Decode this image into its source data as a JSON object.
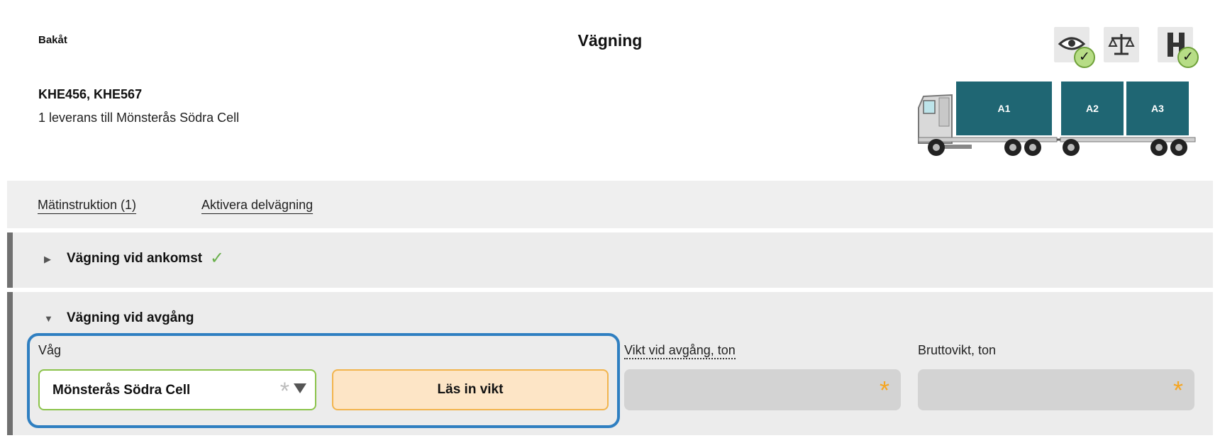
{
  "header": {
    "back_label": "Bakåt",
    "title": "Vägning",
    "trucks": "KHE456, KHE567",
    "delivery": "1 leverans till Mönsterås Södra Cell"
  },
  "status_icons": [
    {
      "name": "eye-icon",
      "checked": true
    },
    {
      "name": "scale-icon",
      "checked": false
    },
    {
      "name": "road-icon",
      "checked": true
    }
  ],
  "containers": [
    {
      "label": "A1"
    },
    {
      "label": "A2"
    },
    {
      "label": "A3"
    }
  ],
  "toolbar": {
    "instruction_link": "Mätinstruktion (1)",
    "partial_link": "Aktivera delvägning"
  },
  "arrival_section": {
    "title": "Vägning vid ankomst",
    "check": "✓"
  },
  "departure_section": {
    "title": "Vägning vid avgång",
    "scale_label": "Våg",
    "scale_value": "Mönsterås Södra Cell",
    "read_button": "Läs in vikt",
    "weight_label": "Vikt vid avgång, ton",
    "gross_label": "Bruttovikt, ton"
  },
  "colors": {
    "accent_blue": "#2f7fc1",
    "container": "#1f6673",
    "success_green": "#6fa13a",
    "required_orange": "#f5a623"
  }
}
